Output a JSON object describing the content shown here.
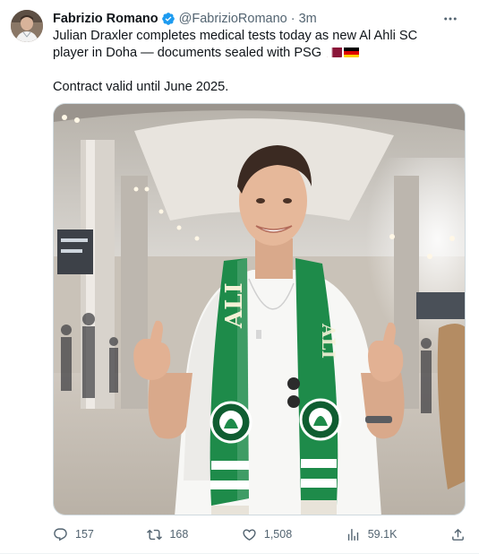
{
  "author": {
    "name": "Fabrizio Romano",
    "handle": "@FabrizioRomano",
    "separator": "·",
    "time": "3m"
  },
  "tweet": {
    "line1": "Julian Draxler completes medical tests today as new Al Ahli SC player in Doha — documents sealed with PSG",
    "line2": "Contract valid until June 2025."
  },
  "flags": [
    "qatar-flag",
    "germany-flag"
  ],
  "media": {
    "scarf_text": "ALI",
    "accent_color": "#1e8b4a"
  },
  "metrics": {
    "replies": "157",
    "reposts": "168",
    "likes": "1,508",
    "views": "59.1K"
  },
  "colors": {
    "text": "#0f1419",
    "secondary": "#536471",
    "verified": "#1d9bf0",
    "border": "#cfd9de"
  }
}
